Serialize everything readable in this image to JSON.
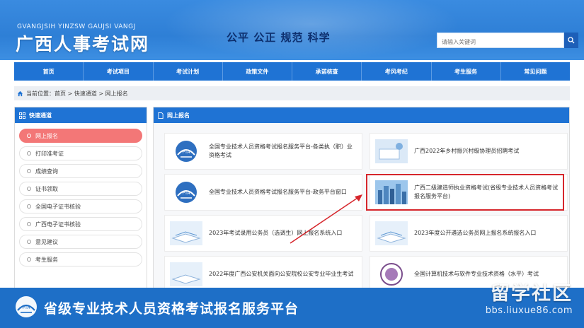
{
  "header": {
    "pinyin": "GVANGJSIH YINZSW GAUJSI VANGJ",
    "site_name": "广西人事考试网",
    "slogan": "公平  公正  规范  科学",
    "search_placeholder": "请输入关键词",
    "search_button": "Q"
  },
  "nav": {
    "items": [
      "首页",
      "考试项目",
      "考试计划",
      "政策文件",
      "承诺核查",
      "考风考纪",
      "考生服务",
      "常见问题"
    ]
  },
  "breadcrumb": {
    "text": "当前位置：首页 > 快速通道 > 网上报名"
  },
  "sidebar": {
    "title": "快速通道",
    "items": [
      "网上报名",
      "打印准考证",
      "成绩查询",
      "证书领取",
      "全国电子证书核验",
      "广西电子证书核验",
      "意见建议",
      "考生服务"
    ],
    "active_index": 0
  },
  "main": {
    "title": "网上报名",
    "cards": [
      "全国专业技术人员资格考试报名服务平台-各类执（职）业资格考试",
      "广西2022年乡村振兴村级协理员招聘考试",
      "全国专业技术人员资格考试报名服务平台-政务平台窗口",
      "广西二级建造师执业资格考试(省级专业技术人员资格考试报名服务平台)",
      "2023年考试录用公务员（选调生）网上报名系统入口",
      "2023年度公开遴选公务员网上报名系统报名入口",
      "2022年度广西公安机关面向公安院校公安专业毕业生考试",
      "全国计算机技术与软件专业技术资格（水平）考试"
    ]
  },
  "banner": {
    "title": "省级专业技术人员资格考试报名服务平台"
  },
  "watermark": {
    "name": "留学社区",
    "url": "bbs.liuxue86.com"
  },
  "colors": {
    "primary": "#1f73d4",
    "active": "#f37777",
    "highlight": "#d6262c"
  }
}
